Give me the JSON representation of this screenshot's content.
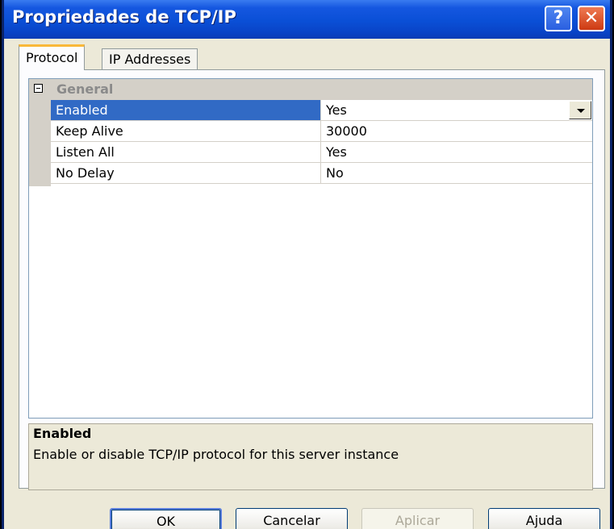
{
  "window": {
    "title": "Propriedades de TCP/IP",
    "help_label": "?",
    "close_label": "✕"
  },
  "tabs": [
    {
      "label": "Protocol",
      "active": true
    },
    {
      "label": "IP Addresses",
      "active": false
    }
  ],
  "property_grid": {
    "category": "General",
    "rows": [
      {
        "name": "Enabled",
        "value": "Yes",
        "selected": true,
        "has_dropdown": true
      },
      {
        "name": "Keep Alive",
        "value": "30000"
      },
      {
        "name": "Listen All",
        "value": "Yes"
      },
      {
        "name": "No Delay",
        "value": "No"
      }
    ]
  },
  "description": {
    "title": "Enabled",
    "text": "Enable or disable TCP/IP protocol for this server instance"
  },
  "buttons": {
    "ok": "OK",
    "cancel": "Cancelar",
    "apply": "Aplicar",
    "help": "Ajuda"
  },
  "colors": {
    "titlebar": "#0a4fd6",
    "selection": "#316ac5",
    "dialog_bg": "#ece9d8"
  },
  "icons": {
    "help": "help-icon",
    "close": "close-icon",
    "collapse": "collapse-icon",
    "dropdown": "chevron-down-icon"
  }
}
